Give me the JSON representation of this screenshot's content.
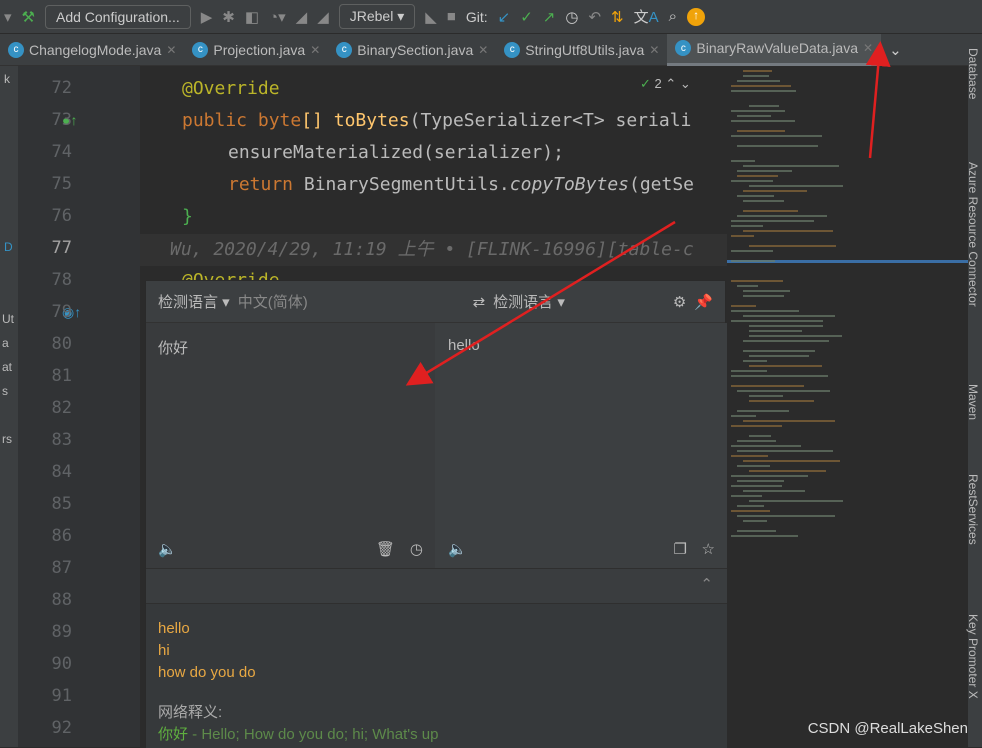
{
  "toolbar": {
    "run_config": "Add Configuration...",
    "jrebel": "JRebel",
    "git_label": "Git:"
  },
  "tabs": [
    {
      "label": "ChangelogMode.java"
    },
    {
      "label": "Projection.java"
    },
    {
      "label": "BinarySection.java"
    },
    {
      "label": "StringUtf8Utils.java"
    },
    {
      "label": "BinaryRawValueData.java",
      "active": true
    }
  ],
  "editor": {
    "line_numbers": [
      "72",
      "73",
      "74",
      "75",
      "76",
      "77",
      "78",
      "79",
      "80",
      "81",
      "82",
      "83",
      "84",
      "85",
      "86",
      "87",
      "88",
      "89",
      "90",
      "91",
      "92"
    ],
    "inspection_count": "2",
    "code": {
      "l72": "@Override",
      "l73_kw1": "public",
      "l73_kw2": "byte",
      "l73_b": "[] ",
      "l73_fn": "toBytes",
      "l73_rest": "(TypeSerializer<T> seriali",
      "l74": "ensureMaterialized(serializer);",
      "l75_kw": "return",
      "l75_cls": " BinarySegmentUtils.",
      "l75_fn": "copyToBytes",
      "l75_rest": "(getSe",
      "l76": "}",
      "l78": "@Override"
    },
    "blame": "Wu, 2020/4/29, 11:19 上午 • [FLINK-16996][table-c"
  },
  "left_strip_fragments": [
    "k",
    "D",
    "Ut",
    "a",
    "at",
    "s",
    "rs"
  ],
  "right_sidebar": [
    "Database",
    "Azure Resource Connector",
    "Maven",
    "RestServices",
    "Key Promoter X"
  ],
  "translator": {
    "source_lang": "检测语言",
    "source_hint": "中文(简体)",
    "target_lang": "检测语言",
    "input_text": "你好",
    "output_text": "hello",
    "translations": [
      "hello",
      "hi",
      "how do you do"
    ],
    "web_label": "网络释义:",
    "web_entry_term": "你好",
    "web_entry_def": " - Hello; How do you do; hi; What's up"
  },
  "watermark": "CSDN @RealLakeShen",
  "colors": {
    "accent_arrow": "#e02020",
    "keyword": "#cc7832",
    "annotation": "#bbb529",
    "translation": "#e8a843",
    "web_term": "#5faf3f"
  }
}
